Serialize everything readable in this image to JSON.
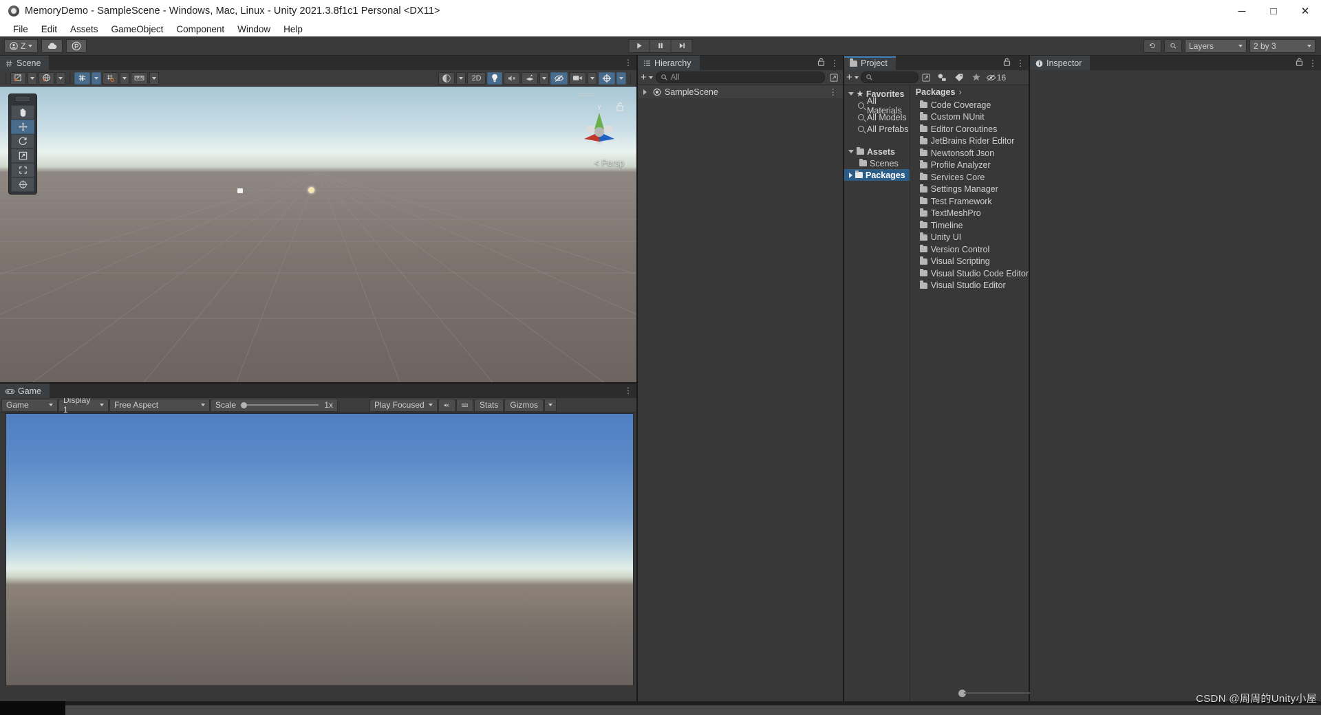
{
  "window": {
    "title": "MemoryDemo - SampleScene - Windows, Mac, Linux - Unity 2021.3.8f1c1 Personal <DX11>",
    "app_icon": "unity-icon",
    "controls": {
      "minimize": "─",
      "maximize": "□",
      "close": "✕"
    }
  },
  "menubar": {
    "items": [
      "File",
      "Edit",
      "Assets",
      "GameObject",
      "Component",
      "Window",
      "Help"
    ]
  },
  "toolbar": {
    "account_label": "Z",
    "account_icon": "account-icon",
    "cloud_icon": "cloud-icon",
    "collab_icon": "collab-icon",
    "play_label": "▶",
    "pause_label": "▐▐",
    "step_label": "▶|",
    "history_icon": "undo-history-icon",
    "search_icon": "search-icon",
    "layers_label": "Layers",
    "layout_label": "2 by 3"
  },
  "scene": {
    "tab_label": "Scene",
    "tab_icon": "scene-grid-icon",
    "tools": [
      {
        "name": "hand-tool",
        "glyph": "✋",
        "active": false
      },
      {
        "name": "move-tool",
        "glyph": "move",
        "active": true
      },
      {
        "name": "rotate-tool",
        "glyph": "rotate",
        "active": false
      },
      {
        "name": "scale-tool",
        "glyph": "scale",
        "active": false
      },
      {
        "name": "rect-tool",
        "glyph": "rect",
        "active": false
      },
      {
        "name": "transform-tool",
        "glyph": "transform",
        "active": false
      }
    ],
    "left_toolbar": [
      {
        "name": "pivot-mode",
        "label": "",
        "icon": "pivot-icon",
        "active": false,
        "dropdown": true
      },
      {
        "name": "handle-space",
        "label": "",
        "icon": "globe-icon",
        "active": false,
        "dropdown": true
      },
      {
        "name": "grid-snap",
        "label": "",
        "icon": "grid-snap-icon",
        "active": true,
        "dropdown": true
      },
      {
        "name": "grid-visibility",
        "label": "",
        "icon": "grid-icon",
        "active": false,
        "dropdown": true
      },
      {
        "name": "snap-increment",
        "label": "",
        "icon": "ruler-icon",
        "active": false,
        "dropdown": true
      }
    ],
    "right_toolbar": [
      {
        "name": "draw-mode",
        "label": "",
        "icon": "shaded-sphere-icon",
        "active": false,
        "dropdown": true
      },
      {
        "name": "2d-toggle",
        "label": "2D",
        "icon": "",
        "active": false,
        "dropdown": false
      },
      {
        "name": "lighting-toggle",
        "label": "",
        "icon": "light-bulb-icon",
        "active": true,
        "dropdown": false
      },
      {
        "name": "audio-toggle",
        "label": "",
        "icon": "mute-audio-icon",
        "active": false,
        "dropdown": false
      },
      {
        "name": "fx-toggle",
        "label": "",
        "icon": "effects-icon",
        "active": false,
        "dropdown": true
      },
      {
        "name": "scene-visibility-toggle",
        "label": "",
        "icon": "hidden-eye-icon",
        "active": true,
        "dropdown": false
      },
      {
        "name": "camera-settings",
        "label": "",
        "icon": "camera-icon",
        "active": false,
        "dropdown": true
      },
      {
        "name": "gizmos-toggle",
        "label": "",
        "icon": "gizmos-icon",
        "active": true,
        "dropdown": true
      }
    ],
    "gizmo": {
      "persp_label": "Persp",
      "axis_x": "x",
      "axis_y": "y",
      "axis_z": "z",
      "lock_icon": "unlock-icon",
      "color_x": "#c0392b",
      "color_y": "#6ab04c",
      "color_z": "#2261c4"
    }
  },
  "game": {
    "tab_label": "Game",
    "tab_icon": "game-controller-icon",
    "view_select": "Game",
    "display_select": "Display 1",
    "aspect_select": "Free Aspect",
    "scale_label": "Scale",
    "scale_value": "1x",
    "play_mode_select": "Play Focused",
    "mute_icon": "audio-icon",
    "stats_label": "Stats",
    "gizmos_label": "Gizmos",
    "keyboard_icon": "keyboard-icon"
  },
  "hierarchy": {
    "tab_label": "Hierarchy",
    "tab_icon": "hierarchy-icon",
    "add_label": "+",
    "search_placeholder": "All",
    "search_icon": "search-icon",
    "lock_icon": "lock-icon",
    "menu_icon": "kebab-menu-icon",
    "rows": [
      {
        "label": "SampleScene",
        "icon": "unity-scene-icon",
        "expandable": true
      }
    ]
  },
  "project": {
    "tab_label": "Project",
    "tab_icon": "folder-icon",
    "add_label": "+",
    "search_placeholder": "",
    "search_icon": "search-icon",
    "filter_icons": [
      "type-filter-icon",
      "label-filter-icon",
      "favorite-star-icon"
    ],
    "hidden_count": "16",
    "lock_icon": "lock-icon",
    "menu_icon": "kebab-menu-icon",
    "breadcrumb": "Packages",
    "tree": [
      {
        "label": "Favorites",
        "icon": "star-icon",
        "indent": 0,
        "bold": true,
        "expanded": true,
        "selected": false
      },
      {
        "label": "All Materials",
        "icon": "search-icon",
        "indent": 1,
        "bold": false,
        "selected": false
      },
      {
        "label": "All Models",
        "icon": "search-icon",
        "indent": 1,
        "bold": false,
        "selected": false
      },
      {
        "label": "All Prefabs",
        "icon": "search-icon",
        "indent": 1,
        "bold": false,
        "selected": false
      },
      {
        "label": "",
        "icon": "",
        "indent": 0,
        "spacer": true
      },
      {
        "label": "Assets",
        "icon": "open-folder-icon",
        "indent": 0,
        "bold": true,
        "expanded": true,
        "selected": false
      },
      {
        "label": "Scenes",
        "icon": "folder-icon",
        "indent": 1,
        "bold": false,
        "selected": false
      },
      {
        "label": "Packages",
        "icon": "folder-icon",
        "indent": 0,
        "bold": true,
        "collapsed": true,
        "selected": true
      }
    ],
    "packages": [
      "Code Coverage",
      "Custom NUnit",
      "Editor Coroutines",
      "JetBrains Rider Editor",
      "Newtonsoft Json",
      "Profile Analyzer",
      "Services Core",
      "Settings Manager",
      "Test Framework",
      "TextMeshPro",
      "Timeline",
      "Unity UI",
      "Version Control",
      "Visual Scripting",
      "Visual Studio Code Editor",
      "Visual Studio Editor"
    ]
  },
  "inspector": {
    "tab_label": "Inspector",
    "tab_icon": "info-icon",
    "lock_icon": "lock-icon",
    "menu_icon": "kebab-menu-icon"
  },
  "statusbar": {
    "watermark": "CSDN @周周的Unity小屋"
  },
  "colors": {
    "accent_blue": "#4a6c8c",
    "selection_blue": "#2c5d87",
    "panel_bg": "#383838",
    "toolbar_bg": "#3c3c3c",
    "tab_bg": "#2c2c2c"
  }
}
